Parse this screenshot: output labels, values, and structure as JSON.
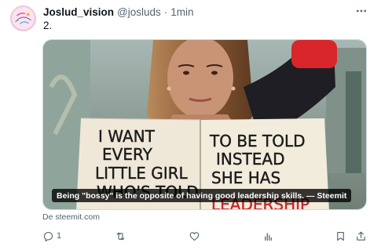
{
  "tweet": {
    "author_name": "Joslud_vision",
    "handle": "@josluds",
    "separator": "·",
    "time": "1min",
    "text": "2.",
    "avatar_icon": "avatar-logo",
    "more_icon": "more-horizontal-icon"
  },
  "card": {
    "notebook_left": [
      "I WANT",
      "EVERY",
      "LITTLE GIRL",
      "WHO'S TOLD"
    ],
    "notebook_right": [
      "TO BE TOLD",
      "INSTEAD",
      "SHE HAS",
      "LEADERSHIP"
    ],
    "caption": "Being \"bossy\" is the opposite of having good leadership skills. — Steemit",
    "source": "De steemit.com"
  },
  "actions": {
    "reply_count": "1",
    "reply_icon": "reply-icon",
    "retweet_icon": "retweet-icon",
    "like_icon": "heart-icon",
    "views_icon": "views-icon",
    "bookmark_icon": "bookmark-icon",
    "share_icon": "share-icon"
  },
  "colors": {
    "text_primary": "#0f1419",
    "text_secondary": "#536471",
    "border": "#cfd9de",
    "jacket_red": "#d8262b",
    "marker_red": "#c7262a"
  }
}
